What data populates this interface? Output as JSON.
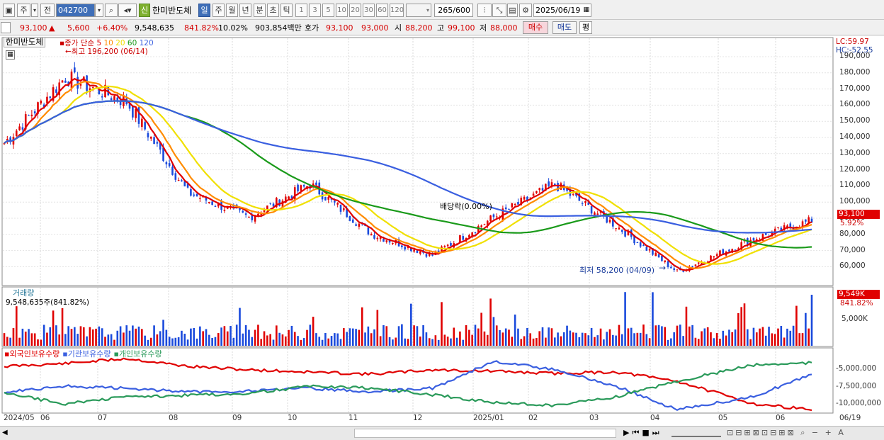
{
  "toolbar": {
    "period_label": "주",
    "prev_label": "전",
    "stock_code": "042700",
    "new_badge": "신",
    "stock_name": "한미반도체",
    "periods": [
      "일",
      "주",
      "월",
      "년",
      "분",
      "초",
      "틱"
    ],
    "intervals": [
      "1",
      "3",
      "5",
      "10",
      "20",
      "30",
      "60",
      "120"
    ],
    "count": "265",
    "count_total": "/600",
    "date": "2025/06/19"
  },
  "quote": {
    "price": "93,100",
    "change_arrow": "▲",
    "change": "5,600",
    "change_pct": "+6.40%",
    "volume": "9,548,635",
    "volume_ratio": "841.82%",
    "turnover": "10.02%",
    "amount": "903,854백만",
    "ask_label": "호가",
    "ask1": "93,100",
    "ask2": "93,000",
    "open_label": "시",
    "open": "88,200",
    "high_label": "고",
    "high": "99,100",
    "low_label": "저",
    "low": "88,000",
    "buy_label": "매수",
    "sell_label": "매도",
    "avg_label": "평"
  },
  "price_panel": {
    "title": "한미반도체",
    "ma_label": "종가 단순",
    "ma_periods": [
      "5",
      "10",
      "20",
      "60",
      "120"
    ],
    "ma_colors": [
      "#e00000",
      "#ff8c00",
      "#f0e000",
      "#1a9a1a",
      "#3a5fe0"
    ],
    "high_note": "←최고 196,200 (06/14)",
    "low_note": "최저 58,200 (04/09)",
    "low_arrow": "→",
    "dividend_note": "배당락(0.00%)",
    "lc": "LC:59.97",
    "hc": "HC:-52.55",
    "last_price_tag": "93,100",
    "last_pct_tag": "5.92%",
    "y_ticks": [
      "190,000",
      "180,000",
      "170,000",
      "160,000",
      "150,000",
      "140,000",
      "130,000",
      "120,000",
      "110,000",
      "100,000",
      "90,000",
      "80,000",
      "70,000",
      "60,000"
    ]
  },
  "volume_panel": {
    "title": "거래량",
    "value_note": "9,548,635주(841.82%)",
    "tag_value": "9,549K",
    "tag_pct": "841.82%",
    "y_tick": "5,000K"
  },
  "holdings_panel": {
    "series": [
      {
        "name": "외국인보유수량",
        "color": "#e00000"
      },
      {
        "name": "기관보유수량",
        "color": "#3a5fe0"
      },
      {
        "name": "개인보유수량",
        "color": "#2a9a5a"
      }
    ],
    "y_ticks": [
      "-5,000,000",
      "-7,500,000",
      "-10,000,000"
    ]
  },
  "x_axis": [
    "2024/05",
    "06",
    "07",
    "08",
    "09",
    "10",
    "11",
    "12",
    "2025/01",
    "02",
    "03",
    "04",
    "05",
    "06",
    "06/19"
  ],
  "chart_data": {
    "type": "line",
    "title": "한미반도체",
    "x": [
      "2024/05",
      "06",
      "07",
      "08",
      "09",
      "10",
      "11",
      "12",
      "2025/01",
      "02",
      "03",
      "04",
      "05",
      "06"
    ],
    "series": [
      {
        "name": "종가",
        "values": [
          140000,
          180000,
          165000,
          110000,
          95000,
          115000,
          85000,
          72000,
          95000,
          115000,
          90000,
          62000,
          82000,
          93100
        ]
      }
    ],
    "ylim": [
      55000,
      200000
    ],
    "annotations": [
      "최고 196,200 (06/14)",
      "최저 58,200 (04/09)",
      "배당락(0.00%)"
    ]
  }
}
